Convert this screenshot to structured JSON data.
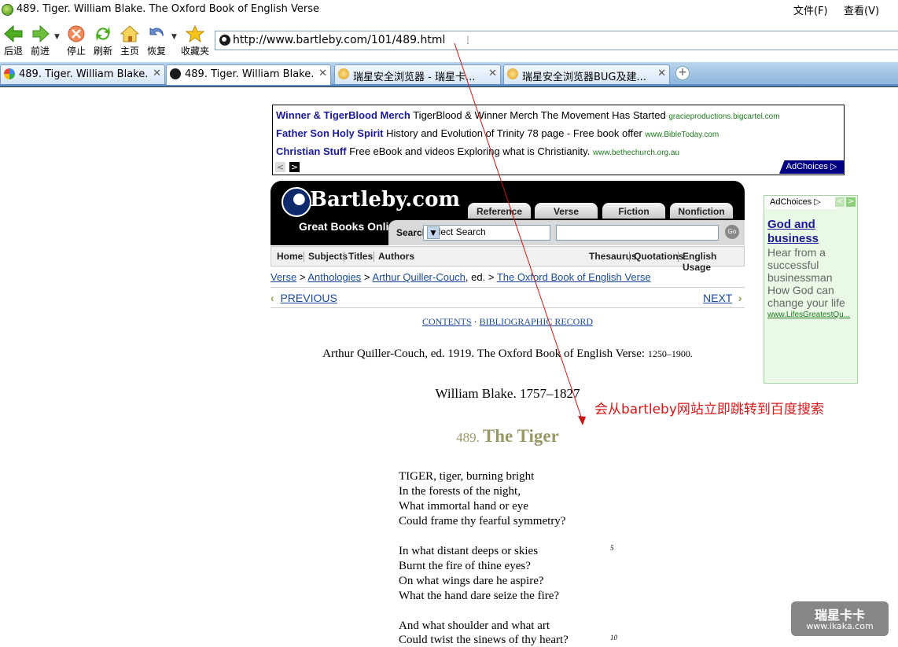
{
  "window": {
    "title": "489. Tiger. William Blake. The Oxford Book of English Verse",
    "menu": [
      "文件(F)",
      "查看(V)"
    ]
  },
  "toolbar": {
    "back": "后退",
    "forward": "前进",
    "stop": "停止",
    "refresh": "刷新",
    "home": "主页",
    "restore": "恢复",
    "favorites": "收藏夹"
  },
  "address": {
    "url": "http://www.bartleby.com/101/489.html"
  },
  "tabs": [
    {
      "label": "489. Tiger. William Blake...",
      "icon": "google-icon"
    },
    {
      "label": "489. Tiger. William Blake...",
      "icon": "globe-icon",
      "active": true
    },
    {
      "label": "瑞星安全浏览器 - 瑞星卡...",
      "icon": "rising-icon"
    },
    {
      "label": "瑞星安全浏览器BUG及建...",
      "icon": "rising-icon"
    }
  ],
  "ads": {
    "top": [
      {
        "title": "Winner & TigerBlood Merch",
        "desc": "TigerBlood & Winner Merch The Movement Has Started",
        "url": "gracieproductions.bigcartel.com"
      },
      {
        "title": "Father Son Holy Spirit",
        "desc": "History and Evolution of Trinity 78 page - Free book offer",
        "url": "www.BibleToday.com"
      },
      {
        "title": "Christian Stuff",
        "desc": "Free eBook and videos Exploring what is Christianity.",
        "url": "www.bethechurch.org.au"
      }
    ],
    "adchoices": "AdChoices",
    "side": {
      "title": "God and business",
      "desc": "Hear from a successful businessman How God can change your life",
      "url": "www.LifesGreatestQu..."
    }
  },
  "site": {
    "logo": "Bartleby.com",
    "tagline": "Great Books Online",
    "tabs": [
      "Reference",
      "Verse",
      "Fiction",
      "Nonfiction"
    ],
    "search_label": "Search",
    "search_select": "Select Search",
    "go": "Go",
    "nav_left": [
      "Home",
      "Subjects",
      "Titles",
      "Authors"
    ],
    "nav_right": [
      "Thesaurus",
      "Quotations",
      "English Usage"
    ]
  },
  "page": {
    "breadcrumb": {
      "verse": "Verse",
      "anthologies": "Anthologies",
      "editor": "Arthur Quiller-Couch",
      "ed_suffix": ", ed. >",
      "book": "The Oxford Book of English Verse"
    },
    "prev": "PREVIOUS",
    "next": "NEXT",
    "contents": "CONTENTS",
    "biblio": "BIBLIOGRAPHIC RECORD",
    "citation": "Arthur Quiller-Couch, ed. 1919. The Oxford Book of English Verse:",
    "citation_years": "1250–1900.",
    "author": "William Blake. 1757–1827",
    "poem_number": "489.",
    "poem_title": "The Tiger",
    "stanzas": [
      [
        "TIGER, tiger, burning bright",
        "In the forests of the night,",
        "What immortal hand or eye",
        "Could frame thy fearful symmetry?"
      ],
      [
        "In what distant deeps or skies",
        "Burnt the fire of thine eyes?",
        "On what wings dare he aspire?",
        "What the hand dare seize the fire?"
      ],
      [
        "And what shoulder and what art",
        "Could twist the sinews of thy heart?"
      ]
    ],
    "line_numbers": [
      "5",
      "10"
    ]
  },
  "annotation": "会从bartleby网站立即跳转到百度搜索",
  "watermark": {
    "title": "瑞星卡卡",
    "url": "www.ikaka.com"
  }
}
